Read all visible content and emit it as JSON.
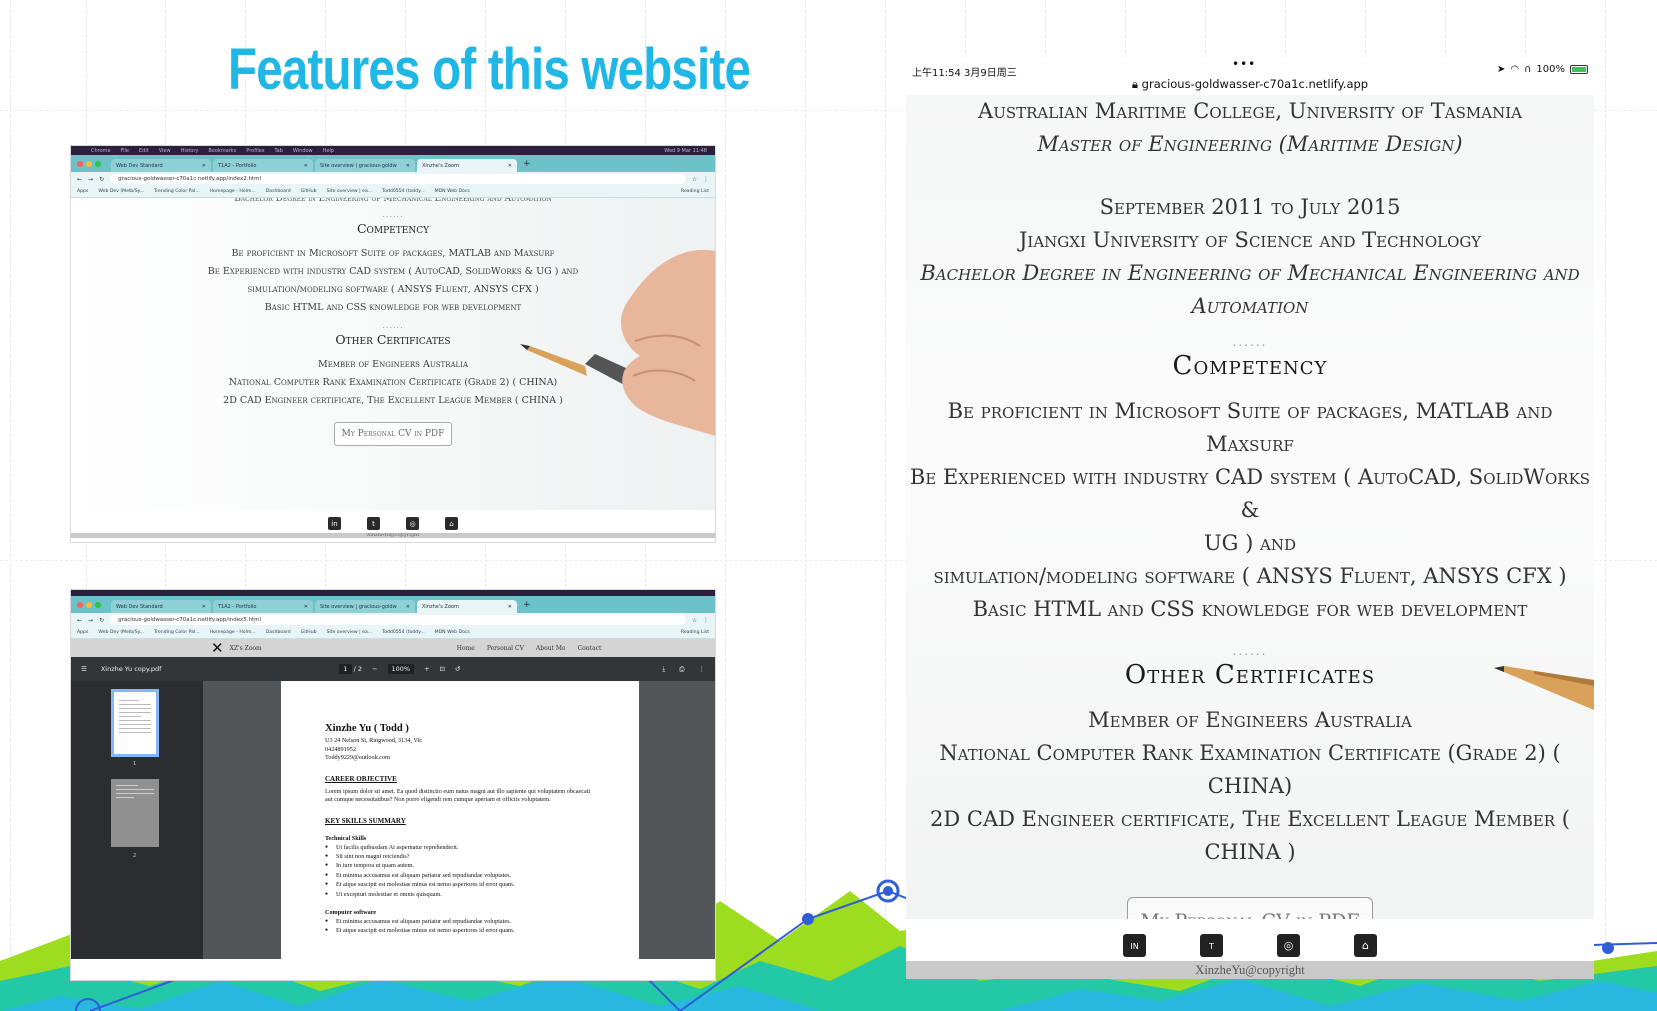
{
  "slide": {
    "title": "Features of this website",
    "title_color": "#1fb7e6"
  },
  "desktop_top": {
    "menubar": [
      "Chrome",
      "File",
      "Edit",
      "View",
      "History",
      "Bookmarks",
      "Profiles",
      "Tab",
      "Window",
      "Help"
    ],
    "menubar_right": "Wed 9 Mar 11:48",
    "tabs": [
      "Web Dev Standard",
      "T1A2 - Portfolio",
      "Site overview | gracious-goldw",
      "Xinzhe's Zoom"
    ],
    "url": "gracious-goldwasser-c70a1c.netlify.app/index2.html",
    "bookmarks": [
      "Apps",
      "Web Dev (Melb/Sy...",
      "Trending Color Pal...",
      "Homepage - Holm...",
      "Dashboard",
      "GitHub",
      "Site overview | ea...",
      "Todd0554 (toddy...",
      "MDN Web Docs",
      "Reading List"
    ],
    "cut_line": "Bachelor Degree in Engineering of Mechanical Engineering and Automation",
    "divider": "......",
    "competency_title": "Competency",
    "competency_lines": [
      "Be proficient in Microsoft Suite of packages, MATLAB and Maxsurf",
      "Be Experienced with industry CAD system ( AutoCAD, SolidWorks & UG ) and",
      "simulation/modeling software ( ANSYS Fluent, ANSYS CFX )",
      "Basic HTML and CSS knowledge for web development"
    ],
    "certs_title": "Other Certificates",
    "certs_lines": [
      "Member of Engineers Australia",
      "National Computer Rank Examination Certificate (Grade 2) ( CHINA)",
      "2D CAD Engineer certificate, The Excellent League Member ( CHINA )"
    ],
    "cv_button": "My Personal CV in PDF",
    "footer_copy": "XinzheYu@copyright",
    "social": [
      "linkedin-icon",
      "twitter-icon",
      "instagram-icon",
      "github-icon"
    ]
  },
  "desktop_bottom": {
    "tabs": [
      "Web Dev Standard",
      "T1A2 - Portfolio",
      "Site overview | gracious-goldw",
      "Xinzhe's Zoom"
    ],
    "url": "gracious-goldwasser-c70a1c.netlify.app/index5.html",
    "bookmarks": [
      "Apps",
      "Web Dev (Melb/Sy...",
      "Trending Color Pal...",
      "Homepage - Holm...",
      "Dashboard",
      "GitHub",
      "Site overview | ea...",
      "Todd0554 (toddy...",
      "MDN Web Docs",
      "Reading List"
    ],
    "brand": "XZ's Zoom",
    "nav": [
      "Home",
      "Personal CV",
      "About Me",
      "Contact"
    ],
    "pdf_filename": "Xinzhe Yu copy.pdf",
    "page_current": "1",
    "page_total": "/ 2",
    "zoom": "100%",
    "thumb_labels": [
      "1",
      "2"
    ],
    "cv": {
      "name": "Xinzhe Yu ( Todd )",
      "address": "U3 24 Nelson St, Ringwood, 3134, Vic",
      "phone": "0424891952",
      "email": "Toddy9229@outlook.com",
      "objective_title": "CAREER OBJECTIVE",
      "objective_text": "Lorem ipsum dolor sit amet. Ea quod distinctio eum natus magni aut illo sapiente qui voluptatem obcaecati aut cumque necessitatibus? Non porro eligendi rem cumque aperiam et officiis voluptatem.",
      "skills_title": "KEY SKILLS SUMMARY",
      "technical_title": "Technical Skills",
      "technical_items": [
        "Ut facilis quibusdam At aspernatur reprehenderit.",
        "Sit sint non magni reiciendis?",
        "In iure tempora ut quam autem.",
        "Et minima accusamus est aliquam pariatur sed repudiandae voluptates.",
        "Et atque suscipit est molestiae minus est nemo asperiores id error quam.",
        "Ut excepturi molestiae et omnis quisquam."
      ],
      "software_title": "Computer software",
      "software_items": [
        "Et minima accusamus est aliquam pariatur sed repudiandae voluptates.",
        "Et atque suscipit est molestiae minus est nemo asperiores id error quam."
      ]
    }
  },
  "ipad": {
    "time": "上午11:54  3月9日周三",
    "dots": "•••",
    "url": "gracious-goldwasser-c70a1c.netlify.app",
    "battery": "100%",
    "edu1": [
      "Australian Maritime College, University of Tasmania",
      "Master of Engineering (Maritime Design)"
    ],
    "edu2": [
      "September 2011 to July 2015",
      "Jiangxi University of Science and Technology",
      "Bachelor Degree in Engineering of Mechanical Engineering and",
      "Automation"
    ],
    "divider": "......",
    "competency_title": "Competency",
    "competency_lines": [
      "Be proficient in Microsoft Suite of packages, MATLAB and Maxsurf",
      "Be Experienced with industry CAD system ( AutoCAD, SolidWorks &",
      "UG ) and",
      "simulation/modeling software ( ANSYS Fluent, ANSYS CFX )",
      "Basic HTML and CSS knowledge for web development"
    ],
    "certs_title": "Other Certificates",
    "certs_lines": [
      "Member of Engineers Australia",
      "National Computer Rank Examination Certificate (Grade 2) ( CHINA)",
      "2D CAD Engineer certificate, The Excellent League Member ( CHINA )"
    ],
    "cv_button": "My Personal CV in PDF",
    "footer_copy": "XinzheYu@copyright"
  }
}
